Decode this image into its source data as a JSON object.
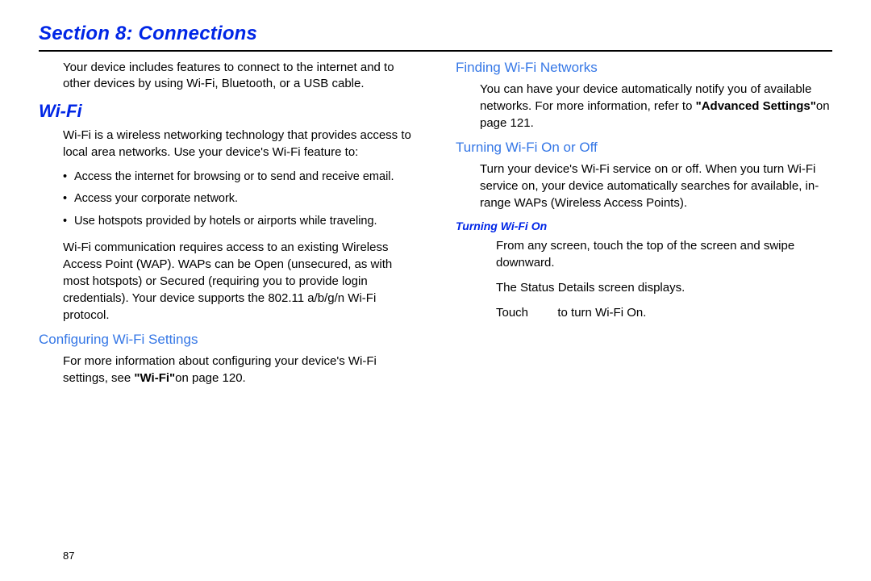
{
  "section_title": "Section 8: Connections",
  "page_number": "87",
  "left": {
    "intro": "Your device includes features to connect to the internet and to other devices by using Wi-Fi, Bluetooth, or a USB cable.",
    "wifi_heading": "Wi-Fi",
    "wifi_intro": "Wi-Fi is a wireless networking technology that provides access to local area networks. Use your device's Wi-Fi feature to:",
    "bullets": [
      "Access the internet for browsing or to send and receive email.",
      "Access your corporate network.",
      "Use hotspots provided by hotels or airports while traveling."
    ],
    "wap_para": "Wi-Fi communication requires access to an existing Wireless Access Point (WAP). WAPs can be Open (unsecured, as with most hotspots) or Secured (requiring you to provide login credentials). Your device supports the 802.11 a/b/g/n Wi-Fi protocol.",
    "config_heading": "Configuring Wi-Fi Settings",
    "config_pre": "For more information about configuring your device's Wi-Fi settings, see ",
    "config_bold": "\"Wi-Fi\"",
    "config_post": "on page 120."
  },
  "right": {
    "finding_heading": "Finding Wi-Fi Networks",
    "finding_pre": "You can have your device automatically notify you of available networks. For more information, refer to ",
    "finding_bold": "\"Advanced Settings\"",
    "finding_post": "on page 121.",
    "turning_heading": "Turning Wi-Fi On or Off",
    "turning_para": "Turn your device's Wi-Fi service on or off. When you turn Wi-Fi service on, your device automatically searches for available, in-range WAPs (Wireless Access Points).",
    "turning_on_heading": "Turning Wi-Fi On",
    "step1": "From any screen, touch the top of the screen and swipe downward.",
    "step1b": "The Status Details screen displays.",
    "step2_pre": "Touch ",
    "step2_post": " to turn Wi-Fi On."
  }
}
